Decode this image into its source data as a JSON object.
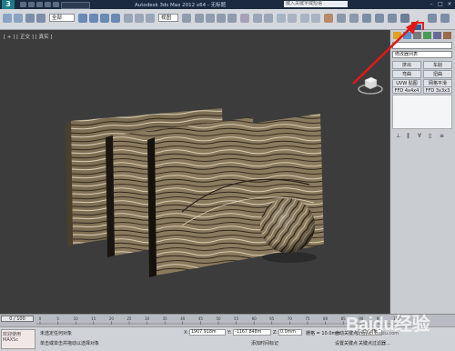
{
  "titlebar": {
    "logo": "3",
    "title": "Autodesk 3ds Max 2012 x64 - 无标题",
    "search_placeholder": "键入关键字或短语",
    "min": "–",
    "max": "□",
    "close": "×"
  },
  "toolbar": {
    "selection_filter": "全部",
    "ref_coord": "视图"
  },
  "viewport": {
    "label": "[ + ] [ 正交 ] [ 真实 ]"
  },
  "command_panel": {
    "dropdown": "修改器列表",
    "buttons": [
      "挤出",
      "车削",
      "弯曲",
      "扭曲",
      "UVW 贴图",
      "网格平滑",
      "FFD 4x4x4",
      "FFD 3x3x3"
    ]
  },
  "timeline": {
    "frame": "0 / 100",
    "ticks": [
      "0",
      "5",
      "10",
      "15",
      "20",
      "25",
      "30",
      "35",
      "40",
      "45",
      "50",
      "55",
      "60",
      "65",
      "70",
      "75",
      "80",
      "85",
      "90",
      "95",
      "100"
    ]
  },
  "status": {
    "maxscript": "欢迎使用 MAXSc",
    "line1": "未选定任何对象",
    "line2": "单击或单击并拖动以选择对象",
    "x_label": "X:",
    "x": "1907.918m",
    "y_label": "Y:",
    "y": "-1167.848m",
    "z_label": "Z:",
    "z": "0.0mm",
    "grid": "栅格 = 10.0mm",
    "auto_key": "自动关键点",
    "selected": "选定对象",
    "set_key": "设置关键点",
    "key_filter": "关键点过滤器...",
    "add_time_tag": "添加时间标记"
  },
  "watermark": {
    "text": "Baidu经验",
    "url": "jingyan.baidu.com"
  }
}
